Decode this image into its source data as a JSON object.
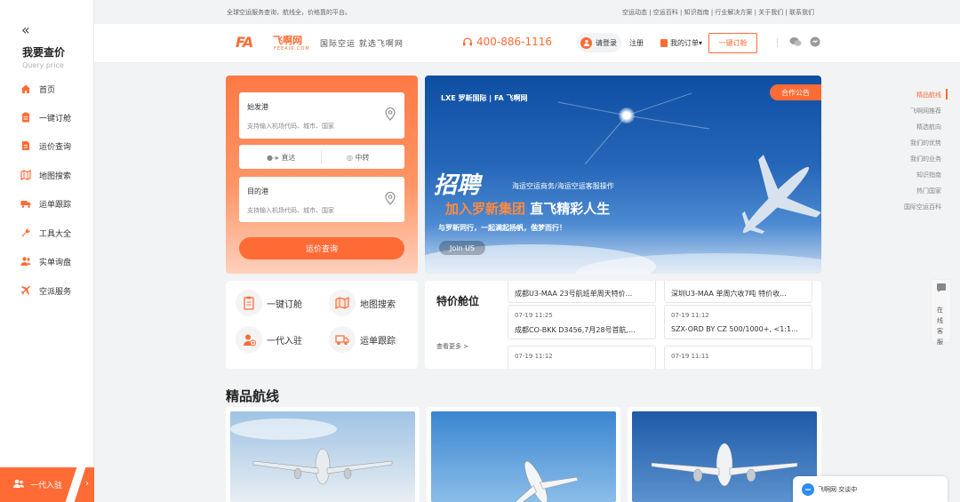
{
  "sidebar": {
    "title": "我要查价",
    "subtitle": "Query price",
    "items": [
      {
        "label": "首页",
        "icon": "home-icon"
      },
      {
        "label": "一键订舱",
        "icon": "clipboard-icon"
      },
      {
        "label": "运价查询",
        "icon": "document-icon"
      },
      {
        "label": "地图搜索",
        "icon": "map-icon"
      },
      {
        "label": "运单跟踪",
        "icon": "truck-icon"
      },
      {
        "label": "工具大全",
        "icon": "wrench-icon"
      },
      {
        "label": "实单询盘",
        "icon": "users-icon"
      },
      {
        "label": "空派服务",
        "icon": "airplane-icon"
      }
    ],
    "join_label": "一代入驻",
    "join_arrow": "›",
    "collapse_glyph": "«"
  },
  "topbar": {
    "slogan": "全球空运服务查询，航线全，价格靠的平台。",
    "links": "空运动态 | 空运百科 | 知识指南 | 行业解决方案 | 关于我们 | 联系我们"
  },
  "header": {
    "logo_mark": "FA",
    "logo_text": "飞啊网",
    "logo_en": "FEEAIR.COM",
    "slogan": "国际空运  就选飞啊网",
    "phone": "400-886-1116",
    "login": "请登录",
    "register": "注册",
    "orders": "我的订单▾",
    "book": "一键订舱"
  },
  "search": {
    "origin_label": "始发港",
    "origin_placeholder": "支持输入机场代码、城市、国家",
    "direct": "直达",
    "transfer": "中转",
    "dest_label": "目的港",
    "dest_placeholder": "支持输入机场代码、城市、国家",
    "query_button": "运价查询"
  },
  "banner": {
    "tag": "合作公告",
    "logos": "LXE 罗新国际 | FA 飞啊网",
    "hire": "招聘",
    "roles": "海运空运商务/海运空运客服操作",
    "headline_a": "加入罗新集团",
    "headline_b": "直飞精彩人生",
    "subline": "与罗新同行，一起满起扬帆，偕梦而行！",
    "join": "Join US"
  },
  "quick_actions": [
    {
      "label": "一键订舱",
      "icon": "clipboard-icon"
    },
    {
      "label": "地图搜索",
      "icon": "map-icon"
    },
    {
      "label": "一代入驻",
      "icon": "user-plus-icon"
    },
    {
      "label": "运单跟踪",
      "icon": "truck-icon"
    }
  ],
  "special": {
    "title": "特价舱位",
    "more": "查看更多 >",
    "cards": [
      {
        "date": "",
        "route": "成都U3-MAA 23号航班单周天特价..."
      },
      {
        "date": "",
        "route": "深圳U3-MAA 单周六收7吨 特价收..."
      },
      {
        "date": "07-19 11:25",
        "route": "成都CO-BKK D3456,7月28号首航,..."
      },
      {
        "date": "07-19 11:12",
        "route": "SZX-ORD BY CZ 500/1000+, <1:1..."
      },
      {
        "date": "07-19 11:12",
        "route": ""
      },
      {
        "date": "07-19 11:11",
        "route": ""
      }
    ]
  },
  "featured": {
    "title": "精品航线"
  },
  "right_nav": [
    "精品航线",
    "飞啊网推荐",
    "精选航向",
    "我们的优势",
    "我们的业务",
    "知识指南",
    "热门国家",
    "国际空运百科"
  ],
  "side_service": "在线客服",
  "chat": {
    "label": "飞啊网  交谈中"
  },
  "colors": {
    "accent": "#ff6b35",
    "banner_blue": "#1a5cb0",
    "background": "#f2f3f5"
  }
}
